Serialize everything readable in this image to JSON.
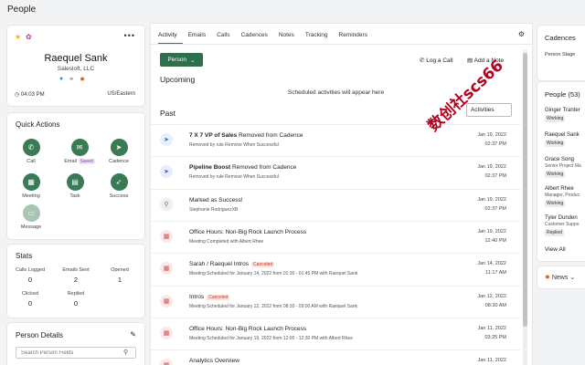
{
  "page": {
    "title": "People"
  },
  "person": {
    "name": "Raequel Sank",
    "company": "Salesloft, LLC",
    "local_time": "04:03 PM",
    "timezone": "US/Eastern"
  },
  "quick_actions": {
    "title": "Quick Actions",
    "items": [
      {
        "label": "Call",
        "icon": "phone-icon"
      },
      {
        "label": "Email",
        "badge": "Saved",
        "icon": "envelope-icon"
      },
      {
        "label": "Cadence",
        "icon": "paper-plane-icon"
      },
      {
        "label": "Meeting",
        "icon": "calendar-icon"
      },
      {
        "label": "Task",
        "icon": "clipboard-icon"
      },
      {
        "label": "Success",
        "icon": "rocket-icon"
      },
      {
        "label": "Message",
        "icon": "message-icon"
      }
    ]
  },
  "stats": {
    "title": "Stats",
    "items": [
      {
        "label": "Calls Logged",
        "value": "0"
      },
      {
        "label": "Emails Sent",
        "value": "2"
      },
      {
        "label": "Opened",
        "value": "1"
      },
      {
        "label": "Clicked",
        "value": "0"
      },
      {
        "label": "Replied",
        "value": "0"
      }
    ]
  },
  "person_details": {
    "title": "Person Details",
    "search_placeholder": "Search Person Fields"
  },
  "tabs": [
    "Activity",
    "Emails",
    "Calls",
    "Cadences",
    "Notes",
    "Tracking",
    "Reminders"
  ],
  "toolbar": {
    "person_label": "Person",
    "log_call": "Log a Call",
    "add_note": "Add a Note"
  },
  "upcoming": {
    "title": "Upcoming",
    "empty_text": "Scheduled activities will appear here"
  },
  "past": {
    "title": "Past",
    "activities_button": "Activities",
    "rows": [
      {
        "bold": "7 X 7 VP of Sales",
        "text": " Removed from Cadence",
        "sub": "Removed by rule Remove When Successful",
        "date": "Jan 19, 2022",
        "time": "02:37 PM",
        "icon": "cadence-icon",
        "tone": "blue"
      },
      {
        "bold": "Pipeline Boost",
        "text": " Removed from Cadence",
        "sub": "Removed by rule Remove When Successful",
        "date": "Jan 19, 2022",
        "time": "02:37 PM",
        "icon": "cadence-icon",
        "tone": "blue"
      },
      {
        "bold": "",
        "text": "Marked as Success!",
        "sub": "Stephanie RodriguezXB",
        "date": "Jan 19, 2022",
        "time": "02:37 PM",
        "icon": "success-icon",
        "tone": "grey"
      },
      {
        "bold": "",
        "text": "Office Hours: Non-Big Rock Launch Process",
        "sub": "Meeting Completed with Albert Rhee",
        "date": "Jan 19, 2022",
        "time": "12:40 PM",
        "icon": "calendar-icon",
        "tone": "pink"
      },
      {
        "bold": "",
        "text": "Sarah / Raequel Intros",
        "canceled": "Canceled",
        "sub": "Meeting Scheduled for January 14, 2022 from 01:30 - 01:45 PM with Raequel Sank",
        "date": "Jan 14, 2022",
        "time": "11:17 AM",
        "icon": "calendar-icon",
        "tone": "pink"
      },
      {
        "bold": "",
        "text": "Intros",
        "canceled": "Canceled",
        "sub": "Meeting Scheduled for January 12, 2022 from 08:30 - 09:00 AM with Raequel Sank",
        "date": "Jan 12, 2022",
        "time": "08:30 AM",
        "icon": "calendar-icon",
        "tone": "pink"
      },
      {
        "bold": "",
        "text": "Office Hours: Non-Big Rock Launch Process",
        "sub": "Meeting Scheduled for January 19, 2022 from 12:00 - 12:30 PM with Albert Rhee",
        "date": "Jan 11, 2022",
        "time": "03:25 PM",
        "icon": "calendar-icon",
        "tone": "pink"
      },
      {
        "bold": "",
        "text": "Analytics Overview",
        "sub": "",
        "date": "Jan 11, 2022",
        "time": "",
        "icon": "calendar-icon",
        "tone": "pink"
      }
    ]
  },
  "cadences": {
    "title": "Cadences",
    "person_stage": "Person Stage"
  },
  "people": {
    "title": "People (53)",
    "items": [
      {
        "name": "Ginger Tranter",
        "title": "",
        "badge": "Working"
      },
      {
        "name": "Raequel Sank",
        "title": "",
        "badge": "Working"
      },
      {
        "name": "Grace Song",
        "title": "Senior Project Ma",
        "badge": "Working"
      },
      {
        "name": "Albert Rhee",
        "title": "Manager, Produc",
        "badge": "Working"
      },
      {
        "name": "Tyler Dunden",
        "title": "Customer Suppo",
        "badge": "Replied"
      }
    ],
    "view_all": "View All"
  },
  "news": {
    "title": "News"
  },
  "watermark": "数创社scs66",
  "colors": {
    "primary": "#2f6f4c",
    "accent": "#3a7a55",
    "canceled": "#c0392b"
  }
}
